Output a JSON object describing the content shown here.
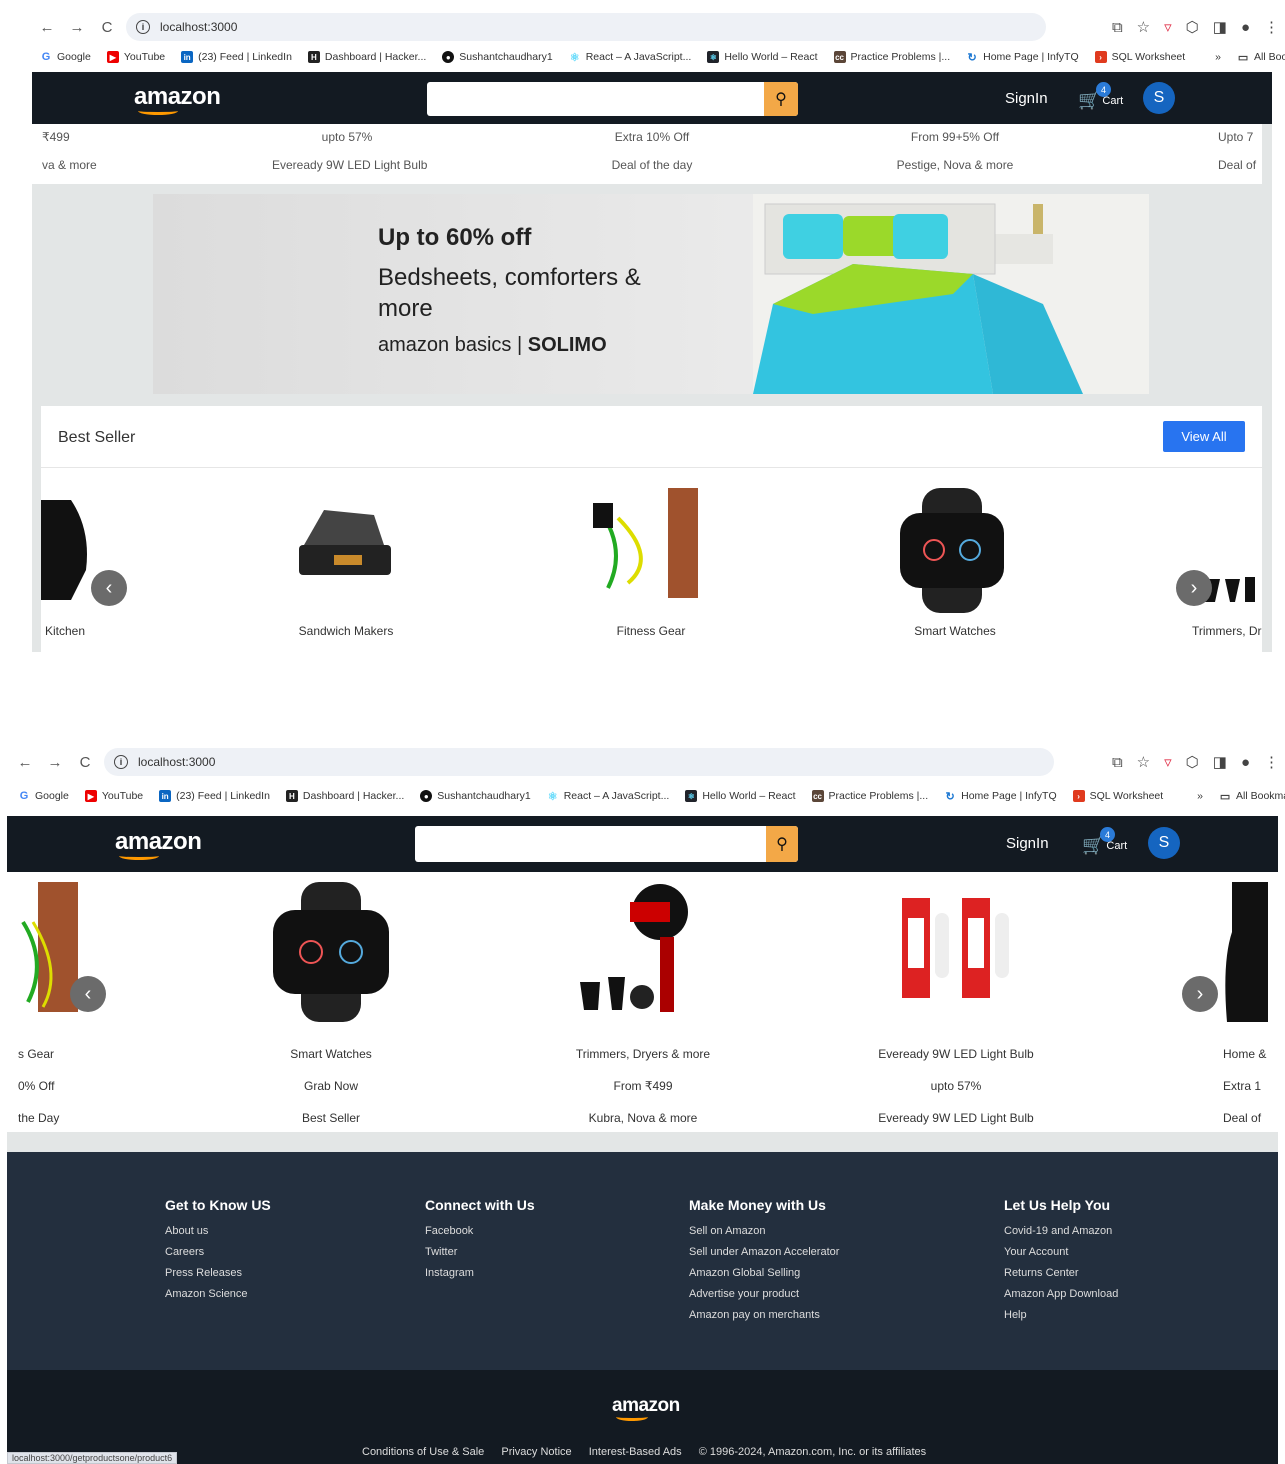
{
  "browser": {
    "url": "localhost:3000",
    "bookmarks": [
      "Google",
      "YouTube",
      "(23) Feed | LinkedIn",
      "Dashboard | Hacker...",
      "Sushantchaudhary1",
      "React – A JavaScript...",
      "Hello World – React",
      "Practice Problems |...",
      "Home Page | InfyTQ",
      "SQL Worksheet"
    ],
    "more": "»",
    "all_bookmarks": "All Bookmarks",
    "status_url": "localhost:3000/getproductsone/product6"
  },
  "header": {
    "logo": "amazon",
    "signin": "SignIn",
    "cart_label": "Cart",
    "cart_count": "4",
    "avatar_letter": "S"
  },
  "deals_strip": {
    "cols": [
      {
        "line1": "₹499",
        "line2": "va & more"
      },
      {
        "line1": "upto 57%",
        "line2": "Eveready 9W LED Light Bulb"
      },
      {
        "line1": "Extra 10% Off",
        "line2": "Deal of the day"
      },
      {
        "line1": "From 99+5% Off",
        "line2": "Pestige, Nova & more"
      },
      {
        "line1": "Upto 7",
        "line2": "Deal of"
      }
    ]
  },
  "banner": {
    "headline": "Up to 60% off",
    "subline": "Bedsheets, comforters & more",
    "brand1": "amazon basics",
    "sep": "|",
    "brand2": "SOLIMO"
  },
  "best_seller": {
    "title": "Best Seller",
    "view_all": "View All",
    "items_top": [
      "Kitchen",
      "Sandwich Makers",
      "Fitness Gear",
      "Smart Watches",
      "Trimmers, Dr"
    ],
    "items_bottom": [
      {
        "name": "s Gear",
        "offer": "0% Off",
        "tag": "the Day"
      },
      {
        "name": "Smart Watches",
        "offer": "Grab Now",
        "tag": "Best Seller"
      },
      {
        "name": "Trimmers, Dryers & more",
        "offer": "From ₹499",
        "tag": "Kubra, Nova & more"
      },
      {
        "name": "Eveready 9W LED Light Bulb",
        "offer": "upto 57%",
        "tag": "Eveready 9W LED Light Bulb"
      },
      {
        "name": "Home &",
        "offer": "Extra 1",
        "tag": "Deal of"
      }
    ]
  },
  "footer": {
    "cols": [
      {
        "heading": "Get to Know US",
        "links": [
          "About us",
          "Careers",
          "Press Releases",
          "Amazon Science"
        ]
      },
      {
        "heading": "Connect with Us",
        "links": [
          "Facebook",
          "Twitter",
          "Instagram"
        ]
      },
      {
        "heading": "Make Money with Us",
        "links": [
          "Sell on Amazon",
          "Sell under Amazon Accelerator",
          "Amazon Global Selling",
          "Advertise your product",
          "Amazon pay on merchants"
        ]
      },
      {
        "heading": "Let Us Help You",
        "links": [
          "Covid-19 and Amazon",
          "Your Account",
          "Returns Center",
          "Amazon App Download",
          "Help"
        ]
      }
    ],
    "logo": "amazon",
    "bottom_links": [
      "Conditions of Use & Sale",
      "Privacy Notice",
      "Interest-Based Ads"
    ],
    "copyright": "© 1996-2024, Amazon.com, Inc. or its affiliates"
  },
  "colors": {
    "header_bg": "#131a22",
    "footer_bg": "#232f3e",
    "accent": "#2874f0",
    "search_btn": "#f3a847"
  }
}
